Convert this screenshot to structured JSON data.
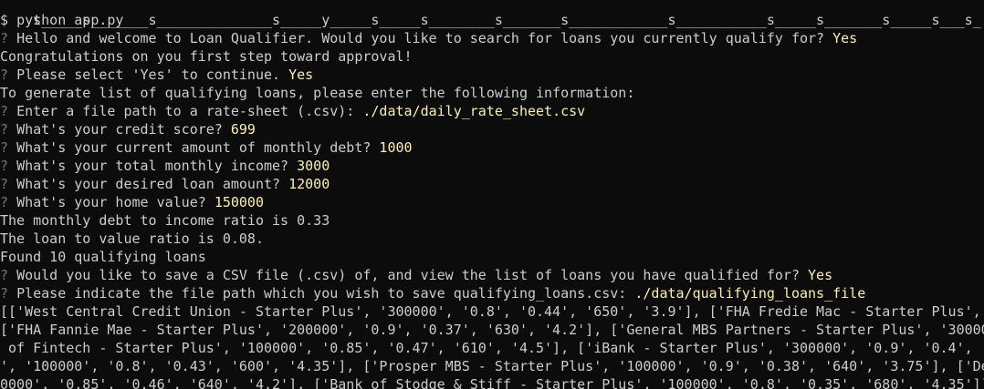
{
  "terminal": {
    "top_fragment": "s_____s_______s______________s_____y_____s_____s________s_______s____________s___________s_____s_______s_____s___s_",
    "prompt_symbol": "$",
    "command": "python app.py",
    "question_mark": "?",
    "lines": {
      "welcome_q": "Hello and welcome to Loan Qualifier. Would you like to search for loans you currently qualify for?",
      "welcome_a": "Yes",
      "congrats": "Congratulations on you first step toward approval!",
      "select_q": "Please select 'Yes' to continue.",
      "select_a": "Yes",
      "generate": "To generate list of qualifying loans, please enter the following information:",
      "filepath_q": "Enter a file path to a rate-sheet (.csv):",
      "filepath_a": "./data/daily_rate_sheet.csv",
      "credit_q": "What's your credit score?",
      "credit_a": "699",
      "debt_q": "What's your current amount of monthly debt?",
      "debt_a": "1000",
      "income_q": "What's your total monthly income?",
      "income_a": "3000",
      "loan_q": "What's your desired loan amount?",
      "loan_a": "12000",
      "home_q": "What's your home value?",
      "home_a": "150000",
      "dti": "The monthly debt to income ratio is 0.33",
      "ltv": "The loan to value ratio is 0.08.",
      "found": "Found 10 qualifying loans",
      "save_q": "Would you like to save a CSV file (.csv) of, and view the list of loans you have qualified for?",
      "save_a": "Yes",
      "path_q": "Please indicate the file path which you wish to save qualifying_loans.csv:",
      "path_a": "./data/qualifying_loans_file",
      "out1": "[['West Central Credit Union - Starter Plus', '300000', '0.8', '0.44', '650', '3.9'], ['FHA Fredie Mac - Starter Plus', ",
      "out2": "['FHA Fannie Mae - Starter Plus', '200000', '0.9', '0.37', '630', '4.2'], ['General MBS Partners - Starter Plus', '300000",
      "out3": " of Fintech - Starter Plus', '100000', '0.85', '0.47', '610', '4.5'], ['iBank - Starter Plus', '300000', '0.9', '0.4', '",
      "out4": "', '100000', '0.8', '0.43', '600', '4.35'], ['Prosper MBS - Starter Plus', '100000', '0.9', '0.38', '640', '3.75'], ['De",
      "out5": "0000', '0.85', '0.46', '640', '4.2'], ['Bank of Stodge & Stiff - Starter Plus', '100000', '0.8', '0.35', '680', '4.35']]"
    }
  },
  "colors": {
    "background": "#0c0c0c",
    "text": "#cccccc",
    "prompt_qmark": "#767676",
    "answer": "#f9f1a5"
  }
}
